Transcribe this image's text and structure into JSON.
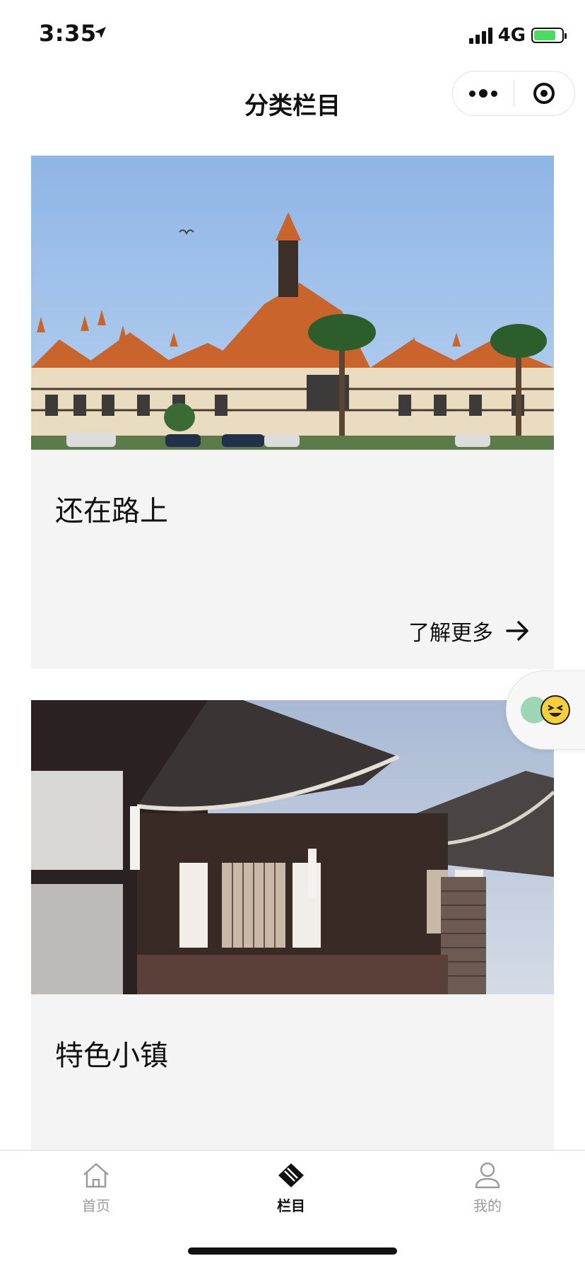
{
  "status_bar": {
    "time": "3:35",
    "network": "4G"
  },
  "nav": {
    "title": "分类栏目"
  },
  "cards": [
    {
      "title": "还在路上",
      "more_label": "了解更多"
    },
    {
      "title": "特色小镇"
    }
  ],
  "tabs": [
    {
      "label": "首页",
      "icon": "home-icon",
      "active": false
    },
    {
      "label": "栏目",
      "icon": "column-icon",
      "active": true
    },
    {
      "label": "我的",
      "icon": "user-icon",
      "active": false
    }
  ],
  "colors": {
    "battery": "#4cd964",
    "card_bg": "#f4f4f4",
    "tab_inactive": "#9b9b9b",
    "tab_active": "#111111"
  }
}
